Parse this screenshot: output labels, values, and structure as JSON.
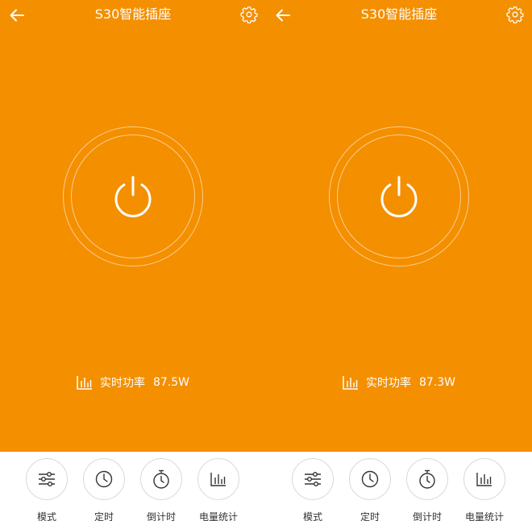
{
  "screens": [
    {
      "title": "S30智能插座",
      "power_label": "实时功率",
      "power_value": "87.5W",
      "actions": [
        {
          "label": "模式",
          "icon": "sliders-icon"
        },
        {
          "label": "定时",
          "icon": "clock-icon"
        },
        {
          "label": "倒计时",
          "icon": "stopwatch-icon"
        },
        {
          "label": "电量统计",
          "icon": "bar-chart-icon"
        }
      ]
    },
    {
      "title": "S30智能插座",
      "power_label": "实时功率",
      "power_value": "87.3W",
      "actions": [
        {
          "label": "模式",
          "icon": "sliders-icon"
        },
        {
          "label": "定时",
          "icon": "clock-icon"
        },
        {
          "label": "倒计时",
          "icon": "stopwatch-icon"
        },
        {
          "label": "电量统计",
          "icon": "bar-chart-icon"
        }
      ]
    }
  ],
  "colors": {
    "accent": "#F48F00",
    "icon_dark": "#333333",
    "bottom_bg": "#FFFFFF"
  }
}
